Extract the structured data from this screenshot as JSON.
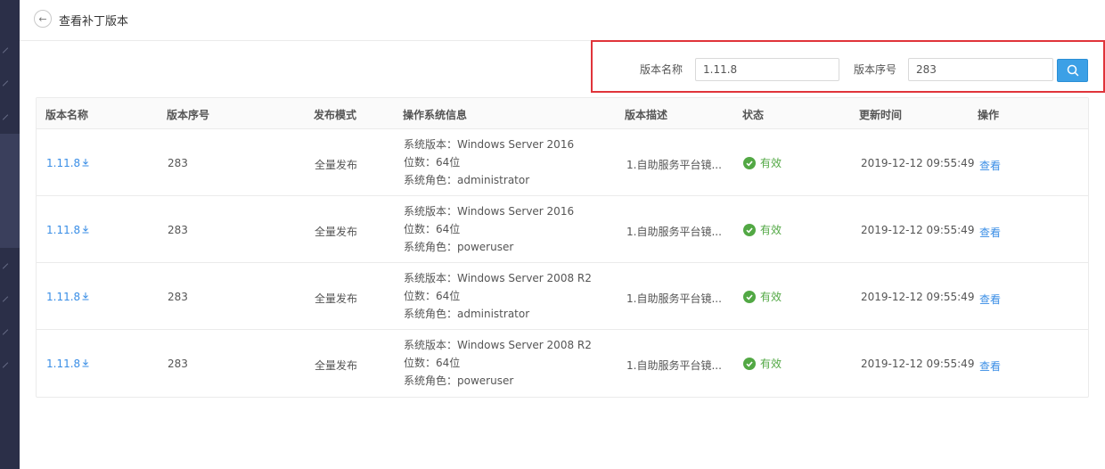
{
  "header": {
    "title": "查看补丁版本"
  },
  "search": {
    "name_label": "版本名称",
    "name_value": "1.11.8",
    "seq_label": "版本序号",
    "seq_value": "283"
  },
  "table": {
    "columns": [
      "版本名称",
      "版本序号",
      "发布模式",
      "操作系统信息",
      "版本描述",
      "状态",
      "更新时间",
      "操作"
    ],
    "rows": [
      {
        "version": "1.11.8",
        "seq": "283",
        "mode": "全量发布",
        "os_version": "系统版本：Windows Server 2016",
        "bits": "位数：64位",
        "role": "系统角色：administrator",
        "desc": "1.自助服务平台镜...",
        "status": "有效",
        "updated": "2019-12-12 09:55:49",
        "action": "查看"
      },
      {
        "version": "1.11.8",
        "seq": "283",
        "mode": "全量发布",
        "os_version": "系统版本：Windows Server 2016",
        "bits": "位数：64位",
        "role": "系统角色：poweruser",
        "desc": "1.自助服务平台镜...",
        "status": "有效",
        "updated": "2019-12-12 09:55:49",
        "action": "查看"
      },
      {
        "version": "1.11.8",
        "seq": "283",
        "mode": "全量发布",
        "os_version": "系统版本：Windows Server 2008 R2",
        "bits": "位数：64位",
        "role": "系统角色：administrator",
        "desc": "1.自助服务平台镜...",
        "status": "有效",
        "updated": "2019-12-12 09:55:49",
        "action": "查看"
      },
      {
        "version": "1.11.8",
        "seq": "283",
        "mode": "全量发布",
        "os_version": "系统版本：Windows Server 2008 R2",
        "bits": "位数：64位",
        "role": "系统角色：poweruser",
        "desc": "1.自助服务平台镜...",
        "status": "有效",
        "updated": "2019-12-12 09:55:49",
        "action": "查看"
      }
    ]
  },
  "colors": {
    "link": "#3a8ee6",
    "status_ok": "#52a844",
    "highlight": "#e0343a",
    "primary": "#3ca0e6",
    "sidebar": "#2b2f48"
  },
  "icons": {
    "back": "arrow-left-icon",
    "search": "search-icon",
    "download": "download-icon",
    "status": "check-circle-icon"
  }
}
